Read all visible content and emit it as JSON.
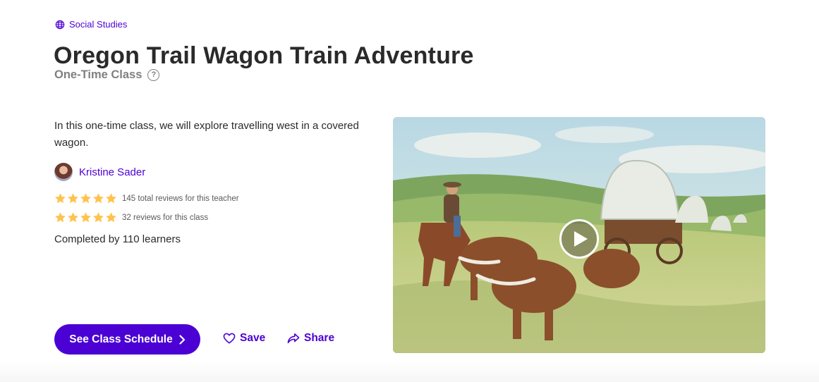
{
  "category": {
    "label": "Social Studies",
    "icon": "globe-icon"
  },
  "title": "Oregon Trail Wagon Train Adventure",
  "class_type": {
    "label": "One-Time Class",
    "help_glyph": "?"
  },
  "summary": "In this one-time class, we will explore travelling west in a covered wagon.",
  "teacher": {
    "name": "Kristine Sader"
  },
  "reviews": [
    {
      "rating": 5,
      "text": "145 total reviews for this teacher"
    },
    {
      "rating": 5,
      "text": "32 reviews for this class"
    }
  ],
  "completed": "Completed by 110 learners",
  "actions": {
    "schedule_label": "See Class Schedule",
    "save_label": "Save",
    "share_label": "Share"
  },
  "colors": {
    "accent": "#4b01d4",
    "star": "#ffc34d",
    "muted": "#808080"
  },
  "media": {
    "type": "video",
    "play_icon": "play-icon"
  }
}
